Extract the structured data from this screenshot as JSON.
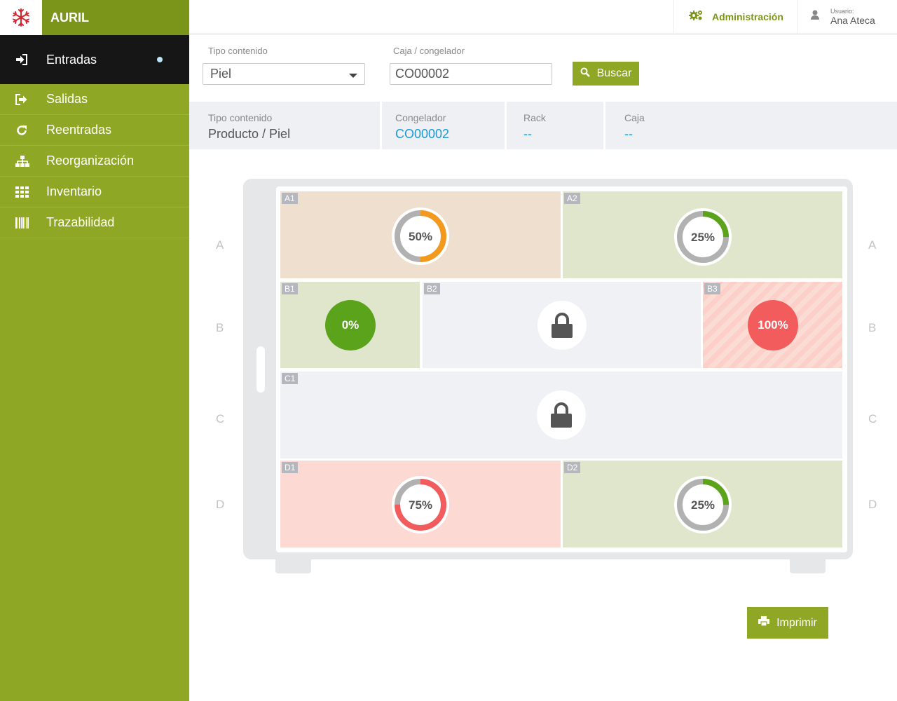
{
  "app": {
    "name": "AURIL",
    "logo_icon": "snowflake-icon",
    "accent": "#8ea825",
    "accent_dark": "#7a9519",
    "link_color": "#1c9ad6"
  },
  "header": {
    "admin_label": "Administración",
    "admin_icon": "gears-icon",
    "user_caption": "Usuario:",
    "user_name": "Ana Ateca",
    "user_icon": "user-icon"
  },
  "sidebar": {
    "items": [
      {
        "label": "Entradas",
        "icon": "sign-in-icon",
        "active": true
      },
      {
        "label": "Salidas",
        "icon": "sign-out-icon"
      },
      {
        "label": "Reentradas",
        "icon": "refresh-icon"
      },
      {
        "label": "Reorganización",
        "icon": "sitemap-icon"
      },
      {
        "label": "Inventario",
        "icon": "grid-icon"
      },
      {
        "label": "Trazabilidad",
        "icon": "barcode-icon"
      }
    ]
  },
  "filters": {
    "content_type_label": "Tipo contenido",
    "content_type_value": "Piel",
    "box_label": "Caja / congelador",
    "box_value": "CO00002",
    "search_label": "Buscar"
  },
  "info": {
    "content_label": "Tipo contenido",
    "content_value": "Producto / Piel",
    "freezer_label": "Congelador",
    "freezer_value": "CO00002",
    "rack_label": "Rack",
    "rack_value": "--",
    "box_label": "Caja",
    "box_value": "--"
  },
  "freezer": {
    "rows": [
      "A",
      "B",
      "C",
      "D"
    ],
    "cells": [
      {
        "id": "A1",
        "status": "partial",
        "fill": 0.5,
        "percent_text": "50%",
        "color": "#f39a1e"
      },
      {
        "id": "A2",
        "status": "partial",
        "fill": 0.25,
        "percent_text": "25%",
        "color": "#5aa31a"
      },
      {
        "id": "B1",
        "status": "empty",
        "fill": 0,
        "percent_text": "0%",
        "color": "#5aa31a"
      },
      {
        "id": "B2",
        "status": "locked"
      },
      {
        "id": "B3",
        "status": "full",
        "fill": 1,
        "percent_text": "100%",
        "color": "#f25c5c"
      },
      {
        "id": "C1",
        "status": "locked"
      },
      {
        "id": "D1",
        "status": "partial",
        "fill": 0.75,
        "percent_text": "75%",
        "color": "#f25c5c"
      },
      {
        "id": "D2",
        "status": "partial",
        "fill": 0.25,
        "percent_text": "25%",
        "color": "#5aa31a"
      }
    ]
  },
  "actions": {
    "print_label": "Imprimir",
    "print_icon": "print-icon"
  }
}
